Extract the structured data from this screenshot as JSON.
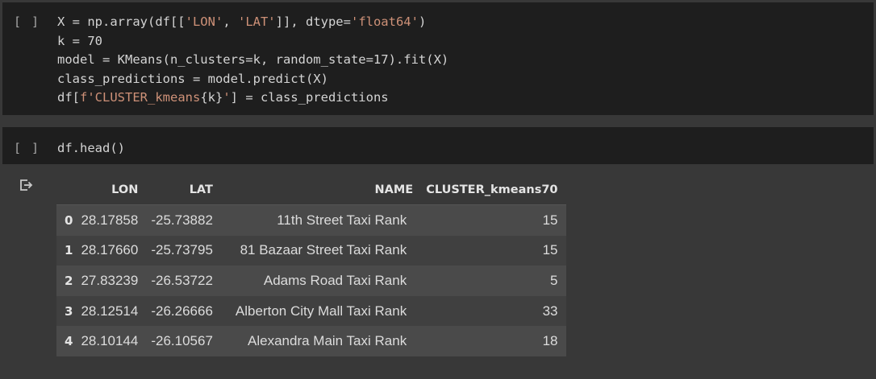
{
  "cells": [
    {
      "run_label": "[ ]",
      "code_lines": [
        [
          "X = np.array(df[[",
          "'LON'",
          ", ",
          "'LAT'",
          "]], dtype=",
          "'float64'",
          ")"
        ],
        [
          "k = 70"
        ],
        [
          "model = KMeans(n_clusters=k, random_state=17).fit(X)"
        ],
        [
          "class_predictions = model.predict(X)"
        ],
        [
          "df[",
          "f'CLUSTER_kmeans",
          "{k}",
          "'",
          "] = class_predictions"
        ]
      ]
    },
    {
      "run_label": "[ ]",
      "code_lines": [
        [
          "df.head()"
        ]
      ]
    }
  ],
  "output": {
    "icon": "output-arrow-icon",
    "columns": [
      "",
      "LON",
      "LAT",
      "NAME",
      "CLUSTER_kmeans70"
    ],
    "rows": [
      {
        "index": "0",
        "lon": "28.17858",
        "lat": "-25.73882",
        "name": "11th Street Taxi Rank",
        "cluster": "15"
      },
      {
        "index": "1",
        "lon": "28.17660",
        "lat": "-25.73795",
        "name": "81 Bazaar Street Taxi Rank",
        "cluster": "15"
      },
      {
        "index": "2",
        "lon": "27.83239",
        "lat": "-26.53722",
        "name": "Adams Road Taxi Rank",
        "cluster": "5"
      },
      {
        "index": "3",
        "lon": "28.12514",
        "lat": "-26.26666",
        "name": "Alberton City Mall Taxi Rank",
        "cluster": "33"
      },
      {
        "index": "4",
        "lon": "28.10144",
        "lat": "-26.10567",
        "name": "Alexandra Main Taxi Rank",
        "cluster": "18"
      }
    ]
  },
  "colors": {
    "cell_bg": "#1e1e1e",
    "page_bg": "#383838",
    "code_text": "#d4d4d4",
    "string": "#ce9178",
    "row_odd": "#4a4a4a",
    "row_even": "#404040"
  }
}
